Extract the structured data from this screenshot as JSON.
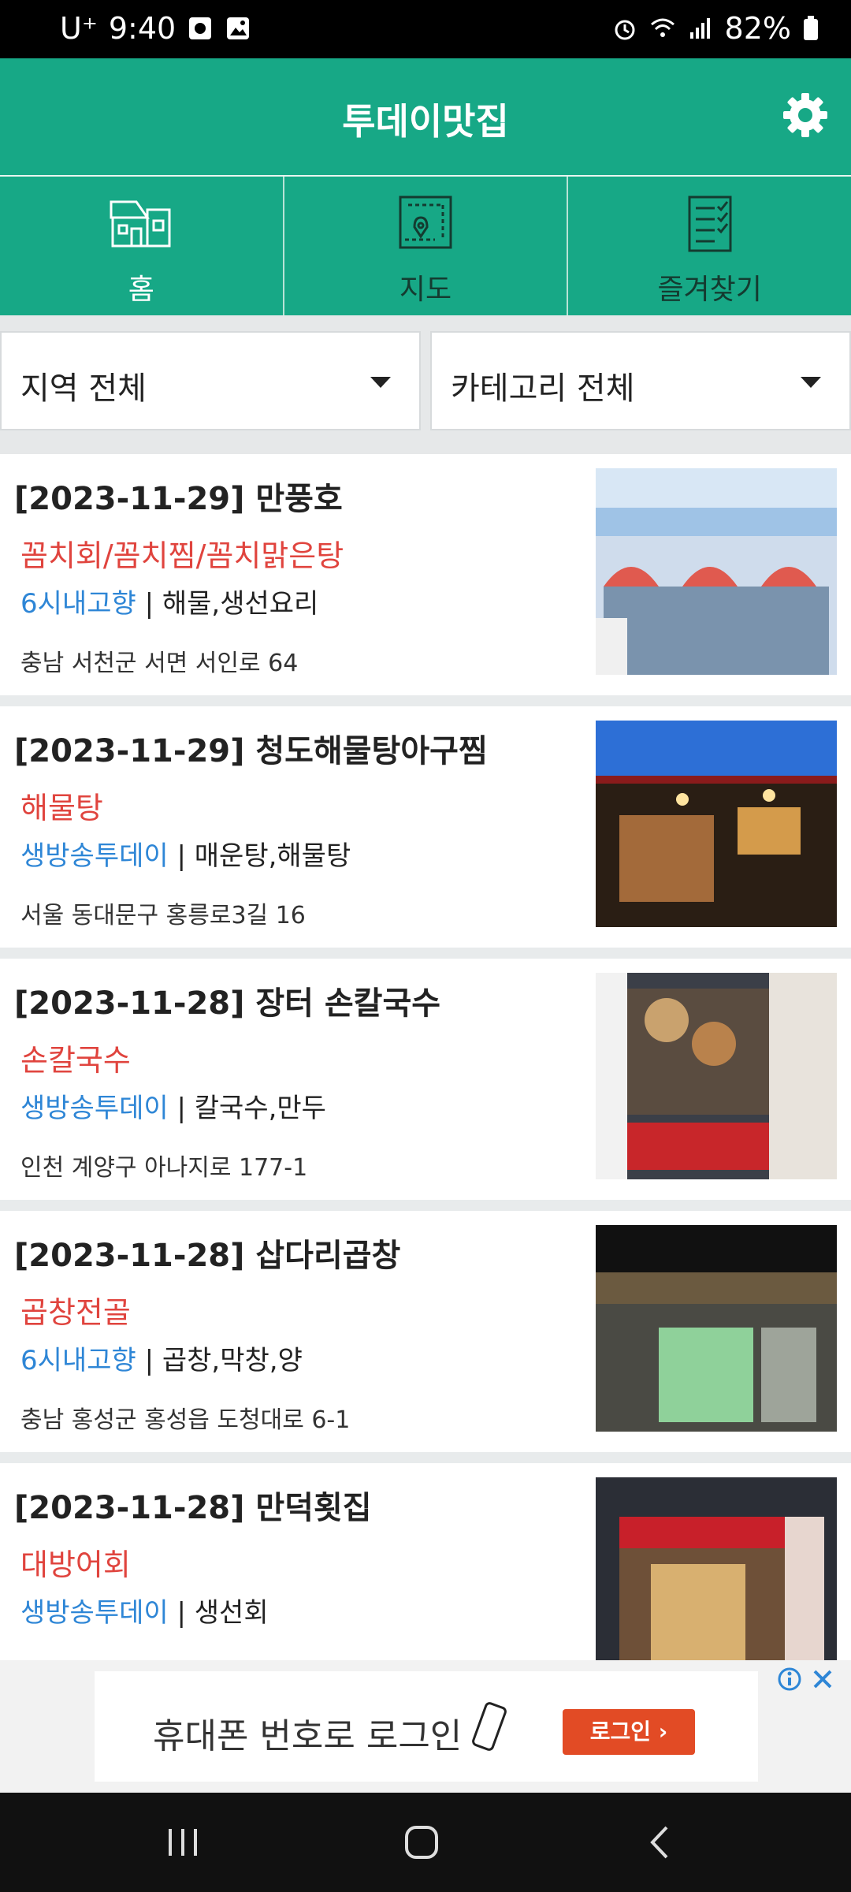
{
  "status": {
    "carrier": "U⁺",
    "time": "9:40",
    "battery": "82%"
  },
  "app": {
    "title": "투데이맛집",
    "brand_color": "#17a886"
  },
  "tabs": [
    {
      "label": "홈",
      "icon": "house-icon",
      "selected": true
    },
    {
      "label": "지도",
      "icon": "map-pin-icon",
      "selected": false
    },
    {
      "label": "즐겨찾기",
      "icon": "checklist-icon",
      "selected": false
    }
  ],
  "filters": {
    "region": "지역 전체",
    "category": "카테고리 전체"
  },
  "restaurants": [
    {
      "header": "[2023-11-29] 만풍호",
      "menu": "꼼치회/꼼치찜/꼼치맑은탕",
      "source": "6시내고향",
      "tags": " | 해물,생선요리",
      "address": "충남 서천군 서면 서인로 64"
    },
    {
      "header": "[2023-11-29] 청도해물탕아구찜",
      "menu": "해물탕",
      "source": "생방송투데이",
      "tags": " | 매운탕,해물탕",
      "address": "서울 동대문구 홍릉로3길 16"
    },
    {
      "header": "[2023-11-28] 장터 손칼국수",
      "menu": "손칼국수",
      "source": "생방송투데이",
      "tags": " | 칼국수,만두",
      "address": "인천 계양구 아나지로 177-1"
    },
    {
      "header": "[2023-11-28] 삽다리곱창",
      "menu": "곱창전골",
      "source": "6시내고향",
      "tags": " | 곱창,막창,양",
      "address": "충남 홍성군 홍성읍 도청대로 6-1"
    },
    {
      "header": "[2023-11-28] 만덕횟집",
      "menu": "대방어회",
      "source": "생방송투데이",
      "tags": " | 생선회",
      "address": ""
    }
  ],
  "ad": {
    "text": "휴대폰 번호로 로그인",
    "button": "로그인"
  }
}
